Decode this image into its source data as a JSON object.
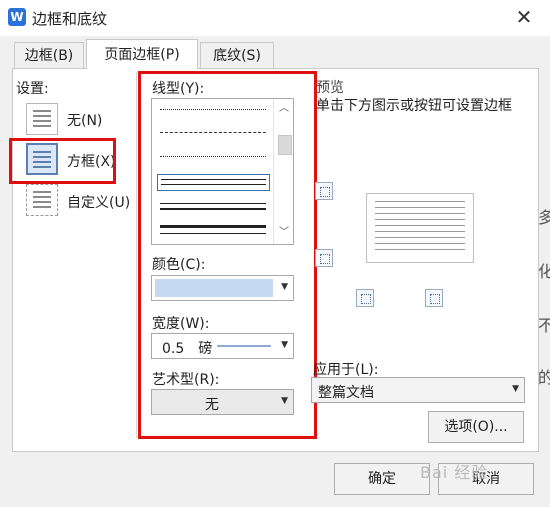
{
  "window": {
    "title": "边框和底纹",
    "app_icon": "W"
  },
  "tabs": [
    {
      "label": "边框(B)",
      "active": false
    },
    {
      "label": "页面边框(P)",
      "active": true
    },
    {
      "label": "底纹(S)",
      "active": false
    }
  ],
  "settings": {
    "label": "设置:",
    "items": [
      {
        "label": "无(N)"
      },
      {
        "label": "方框(X)",
        "selected": true
      },
      {
        "label": "自定义(U)"
      }
    ]
  },
  "line_style": {
    "label": "线型(Y):"
  },
  "color": {
    "label": "颜色(C):",
    "value": "#c5d9f1"
  },
  "width": {
    "label": "宽度(W):",
    "value": "0.5　磅"
  },
  "art": {
    "label": "艺术型(R):",
    "value": "无"
  },
  "preview": {
    "label": "预览",
    "hint": "单击下方图示或按钮可设置边框"
  },
  "apply": {
    "label": "应用于(L):",
    "value": "整篇文档"
  },
  "buttons": {
    "options": "选项(O)...",
    "ok": "确定",
    "cancel": "取消"
  },
  "watermark": "Bai 经验",
  "side_chars": [
    "多",
    "化",
    "不",
    "的"
  ],
  "colors": {
    "highlight": "#e01010",
    "accent": "#2b73d9"
  }
}
